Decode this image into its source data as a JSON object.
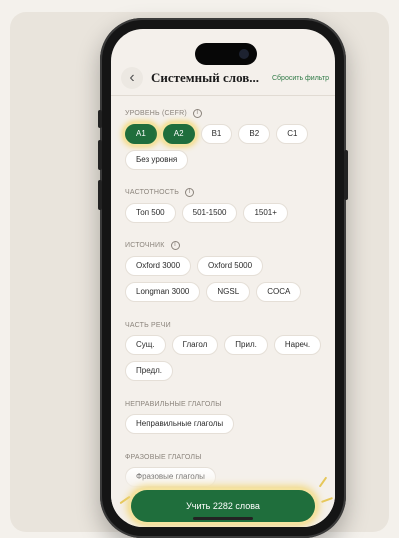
{
  "header": {
    "title": "Системный слов...",
    "reset_label": "Сбросить фильтр",
    "back_icon": "chevron-left-icon"
  },
  "sections": [
    {
      "label": "УРОВЕНЬ (CEFR)",
      "has_info": true,
      "chips": [
        {
          "label": "A1",
          "selected": true
        },
        {
          "label": "A2",
          "selected": true
        },
        {
          "label": "B1",
          "selected": false
        },
        {
          "label": "B2",
          "selected": false
        },
        {
          "label": "C1",
          "selected": false
        },
        {
          "label": "Без уровня",
          "selected": false
        }
      ]
    },
    {
      "label": "ЧАСТОТНОСТЬ",
      "has_info": true,
      "chips": [
        {
          "label": "Топ 500",
          "selected": false
        },
        {
          "label": "501-1500",
          "selected": false
        },
        {
          "label": "1501+",
          "selected": false
        }
      ]
    },
    {
      "label": "ИСТОЧНИК",
      "has_info": true,
      "chips": [
        {
          "label": "Oxford 3000",
          "selected": false
        },
        {
          "label": "Oxford 5000",
          "selected": false
        },
        {
          "label": "Longman 3000",
          "selected": false
        },
        {
          "label": "NGSL",
          "selected": false
        },
        {
          "label": "COCA",
          "selected": false
        }
      ]
    },
    {
      "label": "ЧАСТЬ РЕЧИ",
      "has_info": false,
      "chips": [
        {
          "label": "Сущ.",
          "selected": false
        },
        {
          "label": "Глагол",
          "selected": false
        },
        {
          "label": "Прил.",
          "selected": false
        },
        {
          "label": "Нареч.",
          "selected": false
        },
        {
          "label": "Предл.",
          "selected": false
        }
      ]
    },
    {
      "label": "НЕПРАВИЛЬНЫЕ ГЛАГОЛЫ",
      "has_info": false,
      "chips": [
        {
          "label": "Неправильные глаголы",
          "selected": false
        }
      ]
    },
    {
      "label": "ФРАЗОВЫЕ ГЛАГОЛЫ",
      "has_info": false,
      "chips": [
        {
          "label": "Фразовые глаголы",
          "selected": false
        }
      ]
    }
  ],
  "cta": {
    "label": "Учить 2282 слова"
  },
  "colors": {
    "accent": "#1f6e3c",
    "highlight": "#f3d775",
    "background": "#f4f0eb"
  }
}
